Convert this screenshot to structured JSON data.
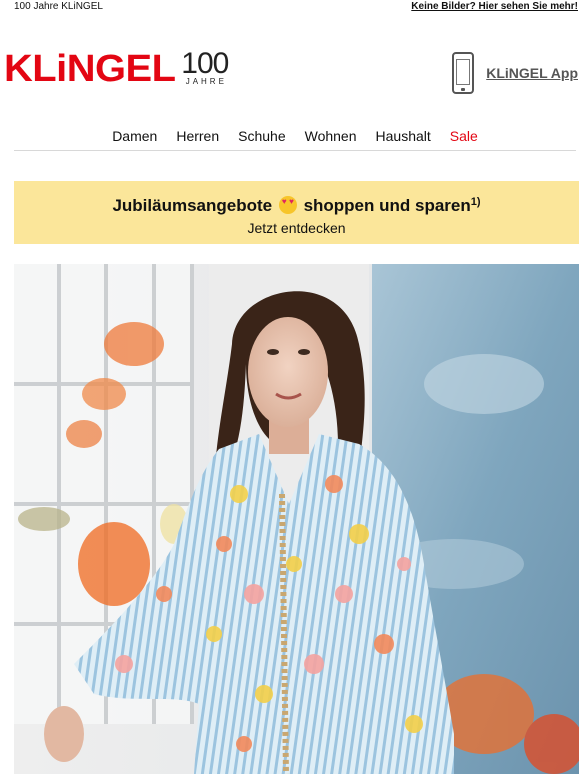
{
  "preheader": {
    "left_text": "100 Jahre KLiNGEL",
    "right_link": "Keine Bilder? Hier sehen Sie mehr!"
  },
  "header": {
    "logo_word": "KLiNGEL",
    "logo_number": "100",
    "logo_sub": "JAHRE",
    "app_label": "KLiNGEL App"
  },
  "nav": {
    "items": [
      "Damen",
      "Herren",
      "Schuhe",
      "Wohnen",
      "Haushalt",
      "Sale"
    ]
  },
  "promo": {
    "title_before": "Jubiläumsangebote",
    "title_after": "shoppen und sparen",
    "footnote": "1)",
    "subtitle": "Jetzt entdecken",
    "background": "#fbe69a"
  },
  "colors": {
    "brand_red": "#e30613"
  },
  "icons": {
    "phone": "phone-icon",
    "emoji": "heart-eyes-emoji-icon"
  }
}
